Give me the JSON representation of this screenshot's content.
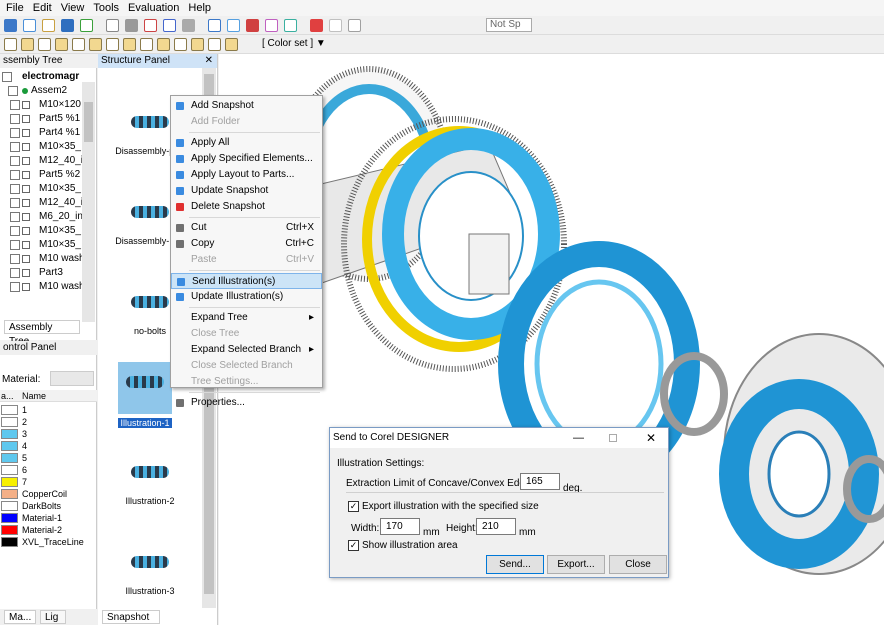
{
  "menubar": [
    "File",
    "Edit",
    "View",
    "Tools",
    "Evaluation",
    "Help"
  ],
  "toolbar": {
    "color_set": "[ Color set ]",
    "not_sp": "Not Sp"
  },
  "assembly_tree": {
    "header": "ssembly Tree",
    "root": "electromagr",
    "assem": "Assem2",
    "items": [
      "M10×120",
      "Part5 %1",
      "Part4 %1",
      "M10×35_",
      "M12_40_i",
      "Part5 %2",
      "M10×35_",
      "M12_40_i",
      "M6_20_in",
      "M10×35_",
      "M10×35_",
      "M10 wash",
      "Part3",
      "M10 wash"
    ],
    "tab": "Assembly Tree"
  },
  "control_panel": {
    "header": "ontrol Panel",
    "material_label": "Material:",
    "col1": "a...",
    "col2": "Name",
    "materials": [
      {
        "name": "1",
        "color": "#ffffff"
      },
      {
        "name": "2",
        "color": "#ffffff"
      },
      {
        "name": "3",
        "color": "#5fc8ee"
      },
      {
        "name": "4",
        "color": "#5fc8ee"
      },
      {
        "name": "5",
        "color": "#5fc8ee"
      },
      {
        "name": "6",
        "color": "#ffffff"
      },
      {
        "name": "7",
        "color": "#f7f000"
      },
      {
        "name": "CopperCoil",
        "color": "#f4b088"
      },
      {
        "name": "DarkBolts",
        "color": "#ffffff"
      },
      {
        "name": "Material-1",
        "color": "#0000ff"
      },
      {
        "name": "Material-2",
        "color": "#ff0000"
      },
      {
        "name": "XVL_TraceLine",
        "color": "#000000"
      }
    ],
    "tabs": [
      "Ma...",
      "Lig"
    ]
  },
  "structure_panel": {
    "header": "Structure Panel",
    "snapshots": [
      "Disassembly-part",
      "Disassembly-ISO",
      "no-bolts",
      "Illustration-1",
      "Illustration-2",
      "Illustration-3"
    ],
    "tab": "Snapshot"
  },
  "context_menu": [
    {
      "label": "Add Snapshot",
      "shortcut": "",
      "disabled": false,
      "icon": "#3a8be0"
    },
    {
      "label": "Add Folder",
      "shortcut": "",
      "disabled": true,
      "icon": ""
    },
    {
      "sep": true
    },
    {
      "label": "Apply All",
      "shortcut": "",
      "disabled": false,
      "icon": "#3a8be0"
    },
    {
      "label": "Apply Specified Elements...",
      "shortcut": "",
      "disabled": false,
      "icon": "#3a8be0"
    },
    {
      "label": "Apply Layout to Parts...",
      "shortcut": "",
      "disabled": false,
      "icon": "#3a8be0"
    },
    {
      "label": "Update Snapshot",
      "shortcut": "",
      "disabled": false,
      "icon": "#3a8be0"
    },
    {
      "label": "Delete Snapshot",
      "shortcut": "",
      "disabled": false,
      "icon": "#e03030"
    },
    {
      "sep": true
    },
    {
      "label": "Cut",
      "shortcut": "Ctrl+X",
      "disabled": false,
      "icon": "#707070"
    },
    {
      "label": "Copy",
      "shortcut": "Ctrl+C",
      "disabled": false,
      "icon": "#707070"
    },
    {
      "label": "Paste",
      "shortcut": "Ctrl+V",
      "disabled": true,
      "icon": ""
    },
    {
      "sep": true
    },
    {
      "label": "Send Illustration(s)",
      "shortcut": "",
      "disabled": false,
      "icon": "#3a8be0",
      "highlight": true
    },
    {
      "label": "Update Illustration(s)",
      "shortcut": "",
      "disabled": false,
      "icon": "#3a8be0"
    },
    {
      "sep": true
    },
    {
      "label": "Expand Tree",
      "shortcut": "",
      "disabled": false,
      "icon": "",
      "arrow": true
    },
    {
      "label": "Close Tree",
      "shortcut": "",
      "disabled": true,
      "icon": ""
    },
    {
      "label": "Expand Selected Branch",
      "shortcut": "",
      "disabled": false,
      "icon": "",
      "arrow": true
    },
    {
      "label": "Close Selected Branch",
      "shortcut": "",
      "disabled": true,
      "icon": ""
    },
    {
      "label": "Tree Settings...",
      "shortcut": "",
      "disabled": true,
      "icon": ""
    },
    {
      "sep": true
    },
    {
      "label": "Properties...",
      "shortcut": "",
      "disabled": false,
      "icon": "#707070"
    }
  ],
  "dialog": {
    "title": "Send to Corel DESIGNER",
    "section": "Illustration Settings:",
    "extraction_label": "Extraction Limit of Concave/Convex Edge:",
    "extraction_value": "165",
    "extraction_unit": "deg.",
    "export_label": "Export illustration with the specified size",
    "width_label": "Width:",
    "width_value": "170",
    "width_unit": "mm",
    "height_label": "Height:",
    "height_value": "210",
    "height_unit": "mm",
    "show_area_label": "Show illustration area",
    "send": "Send...",
    "export": "Export...",
    "close": "Close"
  }
}
